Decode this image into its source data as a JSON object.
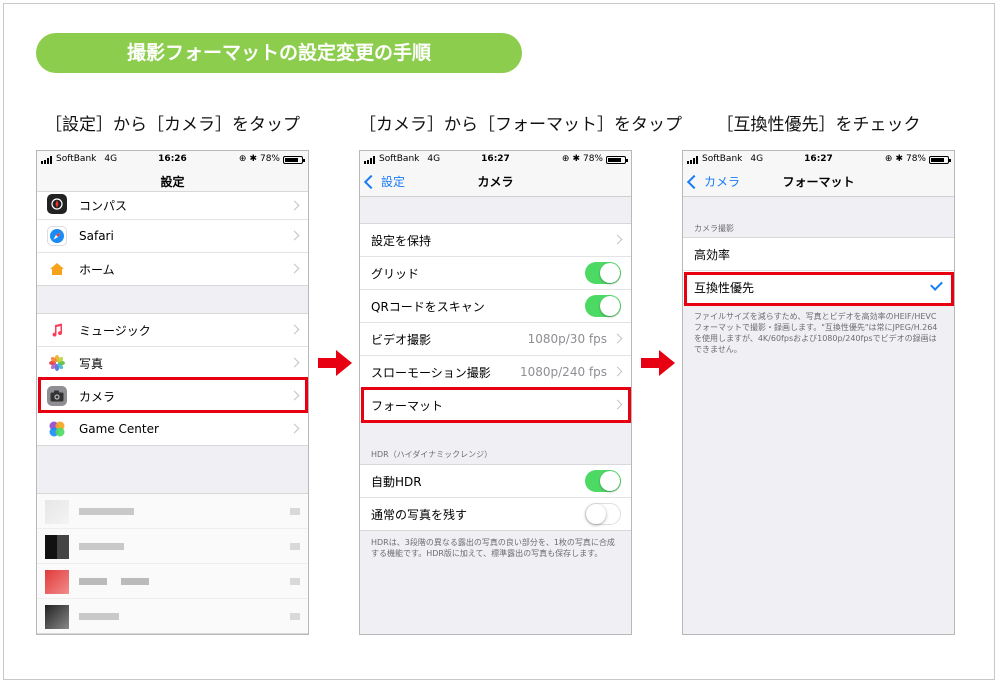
{
  "title": "撮影フォーマットの設定変更の手順",
  "captions": [
    "［設定］から［カメラ］をタップ",
    "［カメラ］から［フォーマット］をタップ",
    "［互換性優先］をチェック"
  ],
  "status": {
    "carrier": "SoftBank",
    "network": "4G",
    "battery": "78%",
    "time_1": "16:26",
    "time_2": "16:27",
    "time_3": "16:27"
  },
  "screen1": {
    "nav_title": "設定",
    "group1": [
      {
        "label": "コンパス",
        "icon": "compass-icon",
        "color": "#222222"
      },
      {
        "label": "Safari",
        "icon": "safari-icon",
        "color": "#1a8cf5"
      },
      {
        "label": "ホーム",
        "icon": "home-icon",
        "color": "#f7a21b"
      }
    ],
    "group2": [
      {
        "label": "ミュージック",
        "icon": "music-icon",
        "color": "#ffffff"
      },
      {
        "label": "写真",
        "icon": "photos-icon",
        "color": "#ffffff"
      },
      {
        "label": "カメラ",
        "icon": "camera-icon",
        "color": "#8e8e93"
      },
      {
        "label": "Game Center",
        "icon": "game-center-icon",
        "color": "#ffffff"
      }
    ]
  },
  "screen2": {
    "back_label": "設定",
    "nav_title": "カメラ",
    "rows": [
      {
        "label": "設定を保持",
        "kind": "chevron"
      },
      {
        "label": "グリッド",
        "kind": "toggle-on"
      },
      {
        "label": "QRコードをスキャン",
        "kind": "toggle-on"
      },
      {
        "label": "ビデオ撮影",
        "kind": "value",
        "value": "1080p/30 fps"
      },
      {
        "label": "スローモーション撮影",
        "kind": "value",
        "value": "1080p/240 fps"
      },
      {
        "label": "フォーマット",
        "kind": "chevron"
      }
    ],
    "hdr_header": "HDR（ハイダイナミックレンジ）",
    "hdr_rows": [
      {
        "label": "自動HDR",
        "kind": "toggle-on"
      },
      {
        "label": "通常の写真を残す",
        "kind": "toggle-off"
      }
    ],
    "hdr_note": "HDRは、3段階の異なる露出の写真の良い部分を、1枚の写真に合成する機能です。HDR版に加えて、標準露出の写真も保存します。"
  },
  "screen3": {
    "back_label": "カメラ",
    "nav_title": "フォーマット",
    "section_header": "カメラ撮影",
    "options": [
      {
        "label": "高効率",
        "checked": false
      },
      {
        "label": "互換性優先",
        "checked": true
      }
    ],
    "note": "ファイルサイズを減らすため、写真とビデオを高効率のHEIF/HEVCフォーマットで撮影・録画します。\"互換性優先\"は常にJPEG/H.264を使用しますが、4K/60fpsおよび1080p/240fpsでビデオの録画はできません。"
  },
  "colors": {
    "accent": "#8ccd4e",
    "highlight": "#e60012",
    "ios_blue": "#1a7cf5",
    "toggle_on": "#4cd964"
  }
}
